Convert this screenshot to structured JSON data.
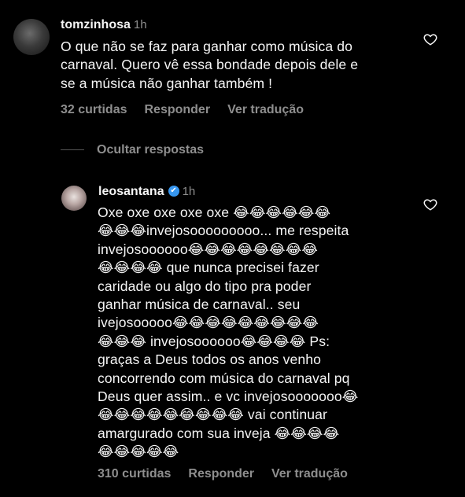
{
  "comment": {
    "username": "tomzinhosa",
    "time": "1h",
    "text": "O que não se faz para ganhar como música do\ncarnaval. Quero vê essa bondade depois dele e\nse a música não ganhar também !",
    "likes": "32 curtidas",
    "reply_label": "Responder",
    "translate_label": "Ver tradução"
  },
  "hide_replies_label": "Ocultar respostas",
  "reply": {
    "username": "leosantana",
    "verified_icon": "✔",
    "time": "1h",
    "text": "Oxe oxe oxe oxe oxe 😂😂😂😂😂😂\n😂😂😂invejosooooooooo... me respeita\ninvejosoooooo😂😂😂😂😂😂😂😂\n😂😂😂😂 que nunca precisei fazer\ncaridade ou algo do tipo pra poder\nganhar música de carnaval.. seu\nivejosooooo😂😂😂😂😂😂😂😂😂\n😂😂😂 invejosoooooo😂😂😂😂 Ps:\ngraças a Deus todos os anos venho\nconcorrendo com música do carnaval pq\nDeus quer assim.. e vc invejosooooooo😂\n😂😂😂😂😂😂😂😂😂 vai continuar\namargurado com sua inveja 😂😂😂😂\n😂😂😂😂😂",
    "likes": "310 curtidas",
    "reply_label": "Responder",
    "translate_label": "Ver tradução"
  },
  "colors": {
    "background": "#000000",
    "text": "#f5f5f5",
    "muted": "#8e8e8e",
    "verified": "#3797f0"
  },
  "icons": [
    "heart-icon",
    "verified-badge-icon"
  ]
}
